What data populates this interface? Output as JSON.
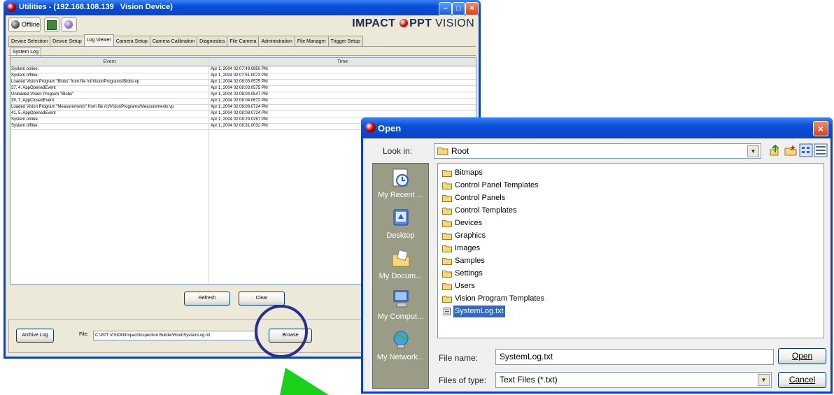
{
  "main_window": {
    "title": "Utilities - (192.168.108.139   Vision Device)",
    "toolbar": {
      "offline_label": "Offline",
      "brand_main": "IMPACT",
      "brand_ppt": "PPT",
      "brand_vision": "VISION"
    },
    "tabs": [
      "Device Selection",
      "Device Setup",
      "Log Viewer",
      "Camera Setup",
      "Camera Calibration",
      "Diagnostics",
      "File Camera",
      "Administration",
      "File Manager",
      "Trigger Setup"
    ],
    "active_tab": "Log Viewer",
    "subtab": "System Log",
    "log_table": {
      "columns": [
        "Event",
        "Time"
      ],
      "rows": [
        {
          "event": "System online.",
          "time": "Apr 1, 2004 02:07:49.0850 PM"
        },
        {
          "event": "System offline.",
          "time": "Apr 1, 2004 02:07:51.0073 PM"
        },
        {
          "event": "Loaded Vision Program \"Blobs\" from file /ct/VisionPrograms/Blobs.vp",
          "time": "Apr 1, 2004 02:08:03.0575 PM"
        },
        {
          "event": "37, 4, AppOpenedEvent",
          "time": "Apr 1, 2004 02:08:03.0575 PM"
        },
        {
          "event": "Unloaded Vision Program \"Blobs\"",
          "time": "Apr 1, 2004 02:08:04.0547 PM"
        },
        {
          "event": "39, 7, AppClosedEvent",
          "time": "Apr 1, 2004 02:08:04.0672 PM"
        },
        {
          "event": "Loaded Vision Program \"Measurements\" from file /ct/VisionPrograms/Measurements.vp",
          "time": "Apr 1, 2004 02:08:08.0724 PM"
        },
        {
          "event": "41, 5, AppOpenedEvent",
          "time": "Apr 1, 2004 02:08:08.0724 PM"
        },
        {
          "event": "System online.",
          "time": "Apr 1, 2004 02:08:29.0257 PM"
        },
        {
          "event": "System offline.",
          "time": "Apr 1, 2004 02:08:31.0032 PM"
        }
      ]
    },
    "refresh_label": "Refresh",
    "clear_label": "Clear",
    "archive_label": "Archive Log",
    "file_label": "File:",
    "file_path": "C:\\PPT VISION\\Impact\\Inspection Builder\\Root\\SystemLog.txt",
    "browse_label": "Browse"
  },
  "open_dialog": {
    "title": "Open",
    "look_in_label": "Look in:",
    "look_in_value": "Root",
    "places": [
      "My Recent ...",
      "Desktop",
      "My Docum...",
      "My Comput...",
      "My Network..."
    ],
    "items": [
      {
        "name": "Bitmaps",
        "type": "folder"
      },
      {
        "name": "Control Panel Templates",
        "type": "folder"
      },
      {
        "name": "Control Panels",
        "type": "folder"
      },
      {
        "name": "Control Templates",
        "type": "folder"
      },
      {
        "name": "Devices",
        "type": "folder"
      },
      {
        "name": "Graphics",
        "type": "folder"
      },
      {
        "name": "Images",
        "type": "folder"
      },
      {
        "name": "Samples",
        "type": "folder"
      },
      {
        "name": "Settings",
        "type": "folder"
      },
      {
        "name": "Users",
        "type": "folder"
      },
      {
        "name": "Vision Program Templates",
        "type": "folder"
      },
      {
        "name": "SystemLog.txt",
        "type": "file",
        "selected": true
      }
    ],
    "file_name_label": "File name:",
    "file_name_value": "SystemLog.txt",
    "file_type_label": "Files of type:",
    "file_type_value": "Text Files (*.txt)",
    "open_label": "Open",
    "cancel_label": "Cancel"
  },
  "colors": {
    "xp_title_blue": "#0a4fd9",
    "xp_face": "#ece9d8",
    "highlight_ring": "#2a2f8e",
    "pointer_arrow": "#19d119",
    "selection": "#316ac5"
  }
}
